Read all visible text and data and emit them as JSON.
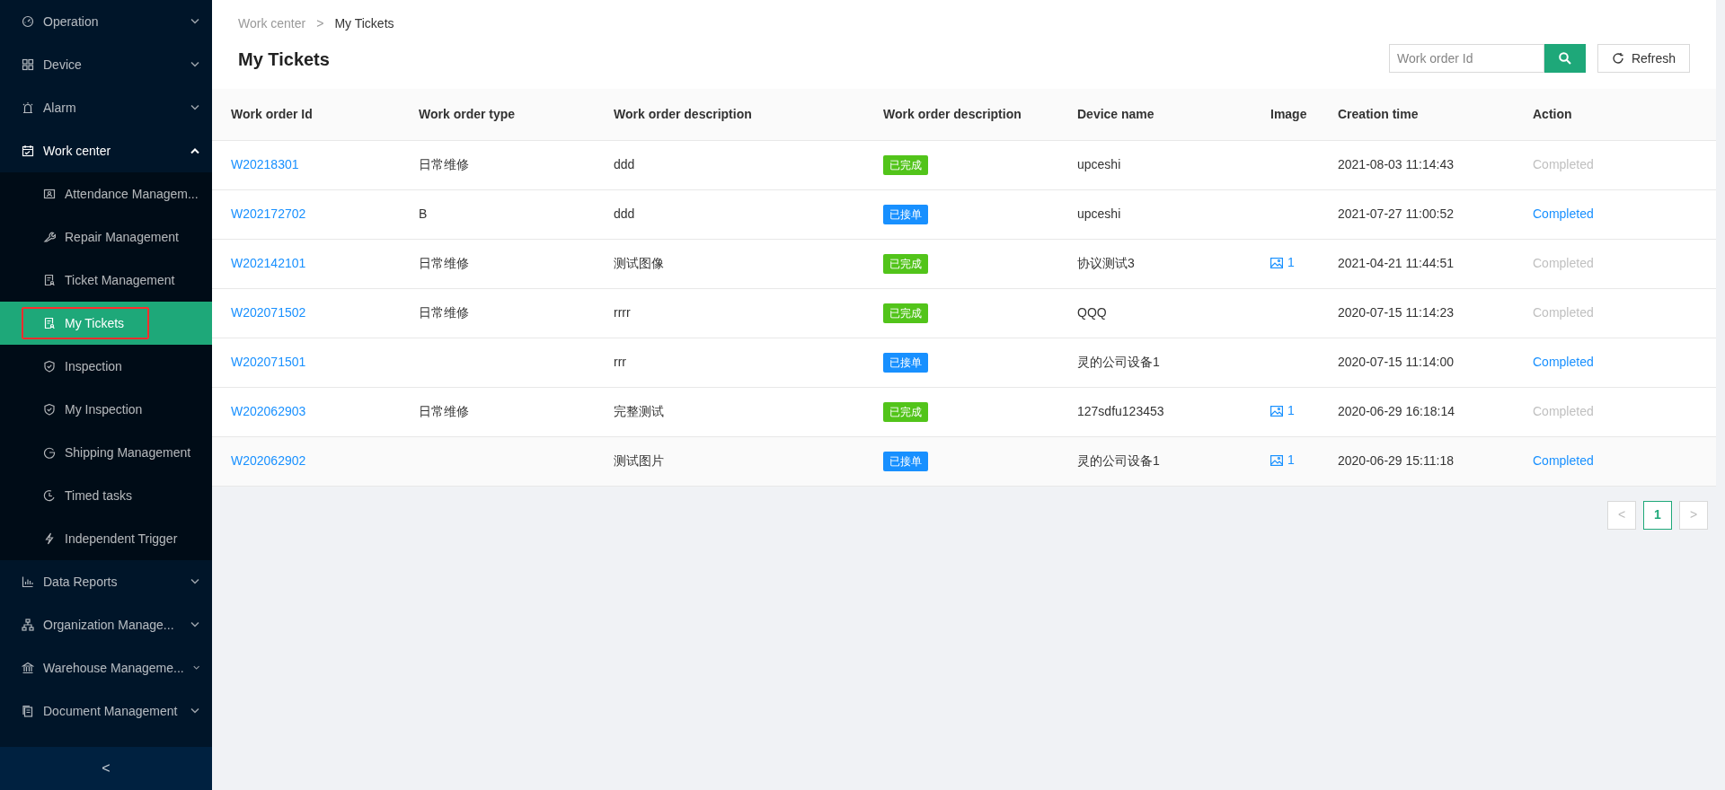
{
  "sidebar": {
    "items": [
      {
        "label": "Operation",
        "expanded": false
      },
      {
        "label": "Device",
        "expanded": false
      },
      {
        "label": "Alarm",
        "expanded": false
      },
      {
        "label": "Work center",
        "expanded": true,
        "children": [
          {
            "label": "Attendance Managem...",
            "selected": false,
            "outlined": false
          },
          {
            "label": "Repair Management",
            "selected": false,
            "outlined": false
          },
          {
            "label": "Ticket Management",
            "selected": false,
            "outlined": false
          },
          {
            "label": "My Tickets",
            "selected": true,
            "outlined": true
          },
          {
            "label": "Inspection",
            "selected": false,
            "outlined": false
          },
          {
            "label": "My Inspection",
            "selected": false,
            "outlined": false
          },
          {
            "label": "Shipping Management",
            "selected": false,
            "outlined": false
          },
          {
            "label": "Timed tasks",
            "selected": false,
            "outlined": false
          },
          {
            "label": "Independent Trigger",
            "selected": false,
            "outlined": false
          }
        ]
      },
      {
        "label": "Data Reports",
        "expanded": false
      },
      {
        "label": "Organization Manage...",
        "expanded": false
      },
      {
        "label": "Warehouse Manageme...",
        "expanded": false
      },
      {
        "label": "Document Management",
        "expanded": false
      }
    ],
    "collapse_button": "<"
  },
  "breadcrumb": [
    "Work center",
    "My Tickets"
  ],
  "breadcrumb_separator": ">",
  "title": "My Tickets",
  "search": {
    "placeholder": "Work order Id"
  },
  "refresh_button": "Refresh",
  "table": {
    "columns": [
      "Work order Id",
      "Work order type",
      "Work order description",
      "Work order description",
      "Device name",
      "Image",
      "Creation time",
      "Action"
    ],
    "rows": [
      {
        "id": "W20218301",
        "type": "日常维修",
        "description": "ddd",
        "status": {
          "text": "已完成",
          "color": "#52c41a"
        },
        "device": "upceshi",
        "image_count": null,
        "time": "2021-08-03 11:14:43",
        "action": {
          "label": "Completed",
          "disabled": true
        },
        "selected": false
      },
      {
        "id": "W202172702",
        "type": "B",
        "description": "ddd",
        "status": {
          "text": "已接单",
          "color": "#1890ff"
        },
        "device": "upceshi",
        "image_count": null,
        "time": "2021-07-27 11:00:52",
        "action": {
          "label": "Completed",
          "disabled": false
        },
        "selected": false
      },
      {
        "id": "W202142101",
        "type": "日常维修",
        "description": "测试图像",
        "status": {
          "text": "已完成",
          "color": "#52c41a"
        },
        "device": "协议测试3",
        "image_count": "1",
        "time": "2021-04-21 11:44:51",
        "action": {
          "label": "Completed",
          "disabled": true
        },
        "selected": false
      },
      {
        "id": "W202071502",
        "type": "日常维修",
        "description": "rrrr",
        "status": {
          "text": "已完成",
          "color": "#52c41a"
        },
        "device": "QQQ",
        "image_count": null,
        "time": "2020-07-15 11:14:23",
        "action": {
          "label": "Completed",
          "disabled": true
        },
        "selected": false
      },
      {
        "id": "W202071501",
        "type": null,
        "description": "rrr",
        "status": {
          "text": "已接单",
          "color": "#1890ff"
        },
        "device": "灵的公司设备1",
        "image_count": null,
        "time": "2020-07-15 11:14:00",
        "action": {
          "label": "Completed",
          "disabled": false
        },
        "selected": false
      },
      {
        "id": "W202062903",
        "type": "日常维修",
        "description": "完整测试",
        "status": {
          "text": "已完成",
          "color": "#52c41a"
        },
        "device": "127sdfu123453",
        "image_count": "1",
        "time": "2020-06-29 16:18:14",
        "action": {
          "label": "Completed",
          "disabled": true
        },
        "selected": false
      },
      {
        "id": "W202062902",
        "type": null,
        "description": "测试图片",
        "status": {
          "text": "已接单",
          "color": "#1890ff"
        },
        "device": "灵的公司设备1",
        "image_count": "1",
        "time": "2020-06-29 15:11:18",
        "action": {
          "label": "Completed",
          "disabled": false
        },
        "selected": true
      }
    ]
  },
  "pagination": {
    "prev": "<",
    "pages": [
      {
        "label": "1",
        "selected": true
      }
    ],
    "next": ">"
  }
}
